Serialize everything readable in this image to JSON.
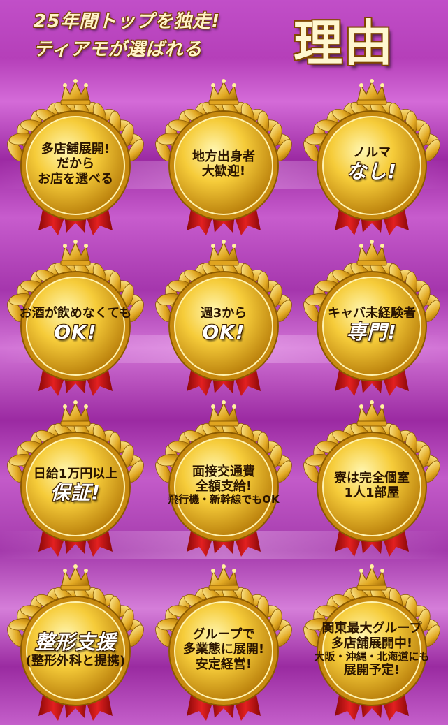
{
  "header": {
    "line1": "25年間トップを独走!",
    "line2": "ティアモが選ばれる",
    "big": "理由"
  },
  "medals": [
    {
      "lines": [
        {
          "t": "多店舗展開!",
          "c": "n"
        },
        {
          "t": "だから",
          "c": "n"
        },
        {
          "t": "お店を選べる",
          "c": "n"
        }
      ]
    },
    {
      "lines": [
        {
          "t": "地方出身者",
          "c": "n"
        },
        {
          "t": "大歓迎!",
          "c": "n"
        }
      ]
    },
    {
      "lines": [
        {
          "t": "ノルマ",
          "c": "n"
        },
        {
          "t": "なし!",
          "c": "em"
        }
      ]
    },
    {
      "lines": [
        {
          "t": "お酒が飲めなくても",
          "c": "n"
        },
        {
          "t": "OK!",
          "c": "em"
        }
      ]
    },
    {
      "lines": [
        {
          "t": "週3から",
          "c": "n"
        },
        {
          "t": "OK!",
          "c": "em"
        }
      ]
    },
    {
      "lines": [
        {
          "t": "キャバ未経験者",
          "c": "n"
        },
        {
          "t": "専門!",
          "c": "em"
        }
      ]
    },
    {
      "lines": [
        {
          "t": "日給1万円以上",
          "c": "n"
        },
        {
          "t": "保証!",
          "c": "em"
        }
      ]
    },
    {
      "lines": [
        {
          "t": "面接交通費",
          "c": "n"
        },
        {
          "t": "全額支給!",
          "c": "n"
        },
        {
          "t": "飛行機・新幹線でもOK",
          "c": "s"
        }
      ]
    },
    {
      "lines": [
        {
          "t": "寮は完全個室",
          "c": "n"
        },
        {
          "t": "1人1部屋",
          "c": "n"
        }
      ]
    },
    {
      "lines": [
        {
          "t": "整形支援",
          "c": "em"
        },
        {
          "t": "(整形外科と提携)",
          "c": "n"
        }
      ]
    },
    {
      "lines": [
        {
          "t": "グループで",
          "c": "n"
        },
        {
          "t": "多業態に展開!",
          "c": "n"
        },
        {
          "t": "安定経営!",
          "c": "n"
        }
      ]
    },
    {
      "lines": [
        {
          "t": "関東最大グループ",
          "c": "n"
        },
        {
          "t": "多店舗展開中!",
          "c": "n"
        },
        {
          "t": "大阪・沖縄・北海道にも",
          "c": "s"
        },
        {
          "t": "展開予定!",
          "c": "n"
        }
      ]
    }
  ],
  "colors": {
    "gold": "#f2c230",
    "red": "#c81414",
    "bg": "#b53fb9"
  }
}
